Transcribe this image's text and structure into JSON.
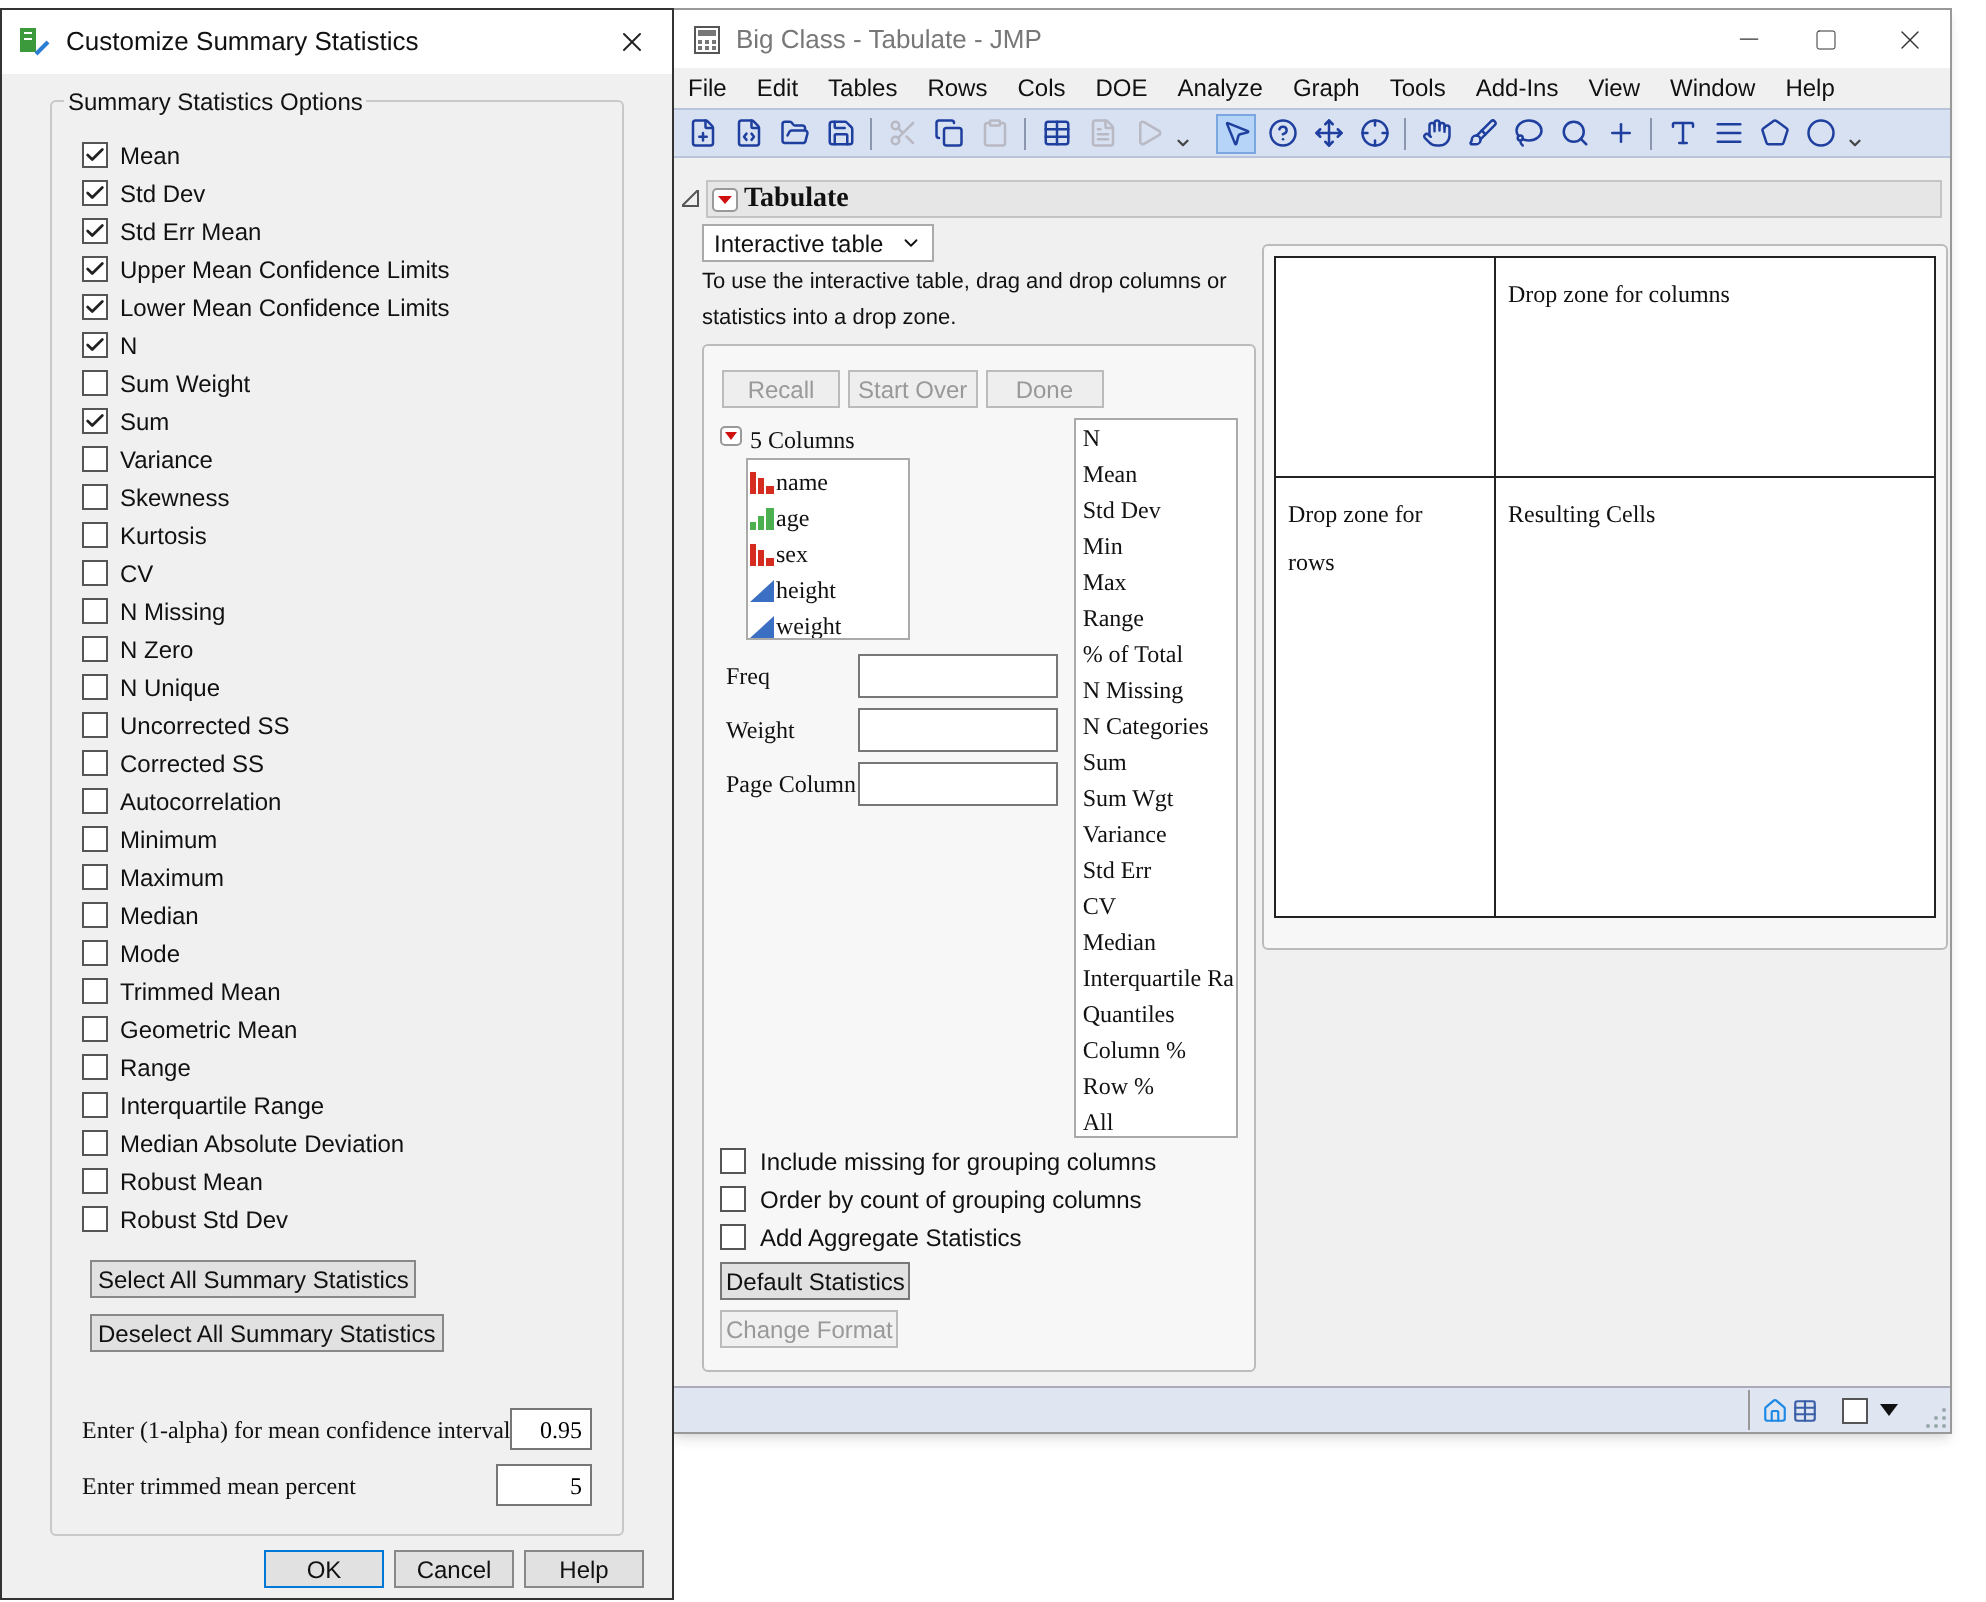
{
  "dialog": {
    "title": "Customize Summary Statistics",
    "group_title": "Summary Statistics Options",
    "options": [
      {
        "label": "Mean",
        "checked": true
      },
      {
        "label": "Std Dev",
        "checked": true
      },
      {
        "label": "Std Err Mean",
        "checked": true
      },
      {
        "label": "Upper Mean Confidence Limits",
        "checked": true
      },
      {
        "label": "Lower Mean Confidence Limits",
        "checked": true
      },
      {
        "label": "N",
        "checked": true
      },
      {
        "label": "Sum Weight",
        "checked": false
      },
      {
        "label": "Sum",
        "checked": true
      },
      {
        "label": "Variance",
        "checked": false
      },
      {
        "label": "Skewness",
        "checked": false
      },
      {
        "label": "Kurtosis",
        "checked": false
      },
      {
        "label": "CV",
        "checked": false
      },
      {
        "label": "N Missing",
        "checked": false
      },
      {
        "label": "N Zero",
        "checked": false
      },
      {
        "label": "N Unique",
        "checked": false
      },
      {
        "label": "Uncorrected SS",
        "checked": false
      },
      {
        "label": "Corrected SS",
        "checked": false
      },
      {
        "label": "Autocorrelation",
        "checked": false
      },
      {
        "label": "Minimum",
        "checked": false
      },
      {
        "label": "Maximum",
        "checked": false
      },
      {
        "label": "Median",
        "checked": false
      },
      {
        "label": "Mode",
        "checked": false
      },
      {
        "label": "Trimmed Mean",
        "checked": false
      },
      {
        "label": "Geometric Mean",
        "checked": false
      },
      {
        "label": "Range",
        "checked": false
      },
      {
        "label": "Interquartile Range",
        "checked": false
      },
      {
        "label": "Median Absolute Deviation",
        "checked": false
      },
      {
        "label": "Robust Mean",
        "checked": false
      },
      {
        "label": "Robust Std Dev",
        "checked": false
      }
    ],
    "select_buttons": [
      "Select All Summary Statistics",
      "Deselect All Summary Statistics"
    ],
    "fields": [
      {
        "label": "Enter (1-alpha) for mean confidence interval",
        "value": "0.95"
      },
      {
        "label": "Enter trimmed mean percent",
        "value": "5"
      }
    ],
    "footer_buttons": [
      {
        "label": "OK",
        "selected": true
      },
      {
        "label": "Cancel",
        "selected": false
      },
      {
        "label": "Help",
        "selected": false
      }
    ]
  },
  "window": {
    "title": "Big Class - Tabulate - JMP",
    "menu": [
      "File",
      "Edit",
      "Tables",
      "Rows",
      "Cols",
      "DOE",
      "Analyze",
      "Graph",
      "Tools",
      "Add-Ins",
      "View",
      "Window",
      "Help"
    ],
    "toolbar": [
      {
        "kind": "new-table",
        "disabled": false,
        "selected": false
      },
      {
        "kind": "new-script",
        "disabled": false,
        "selected": false
      },
      {
        "kind": "open",
        "disabled": false,
        "selected": false
      },
      {
        "kind": "save",
        "disabled": false,
        "selected": false
      },
      {
        "kind": "sep"
      },
      {
        "kind": "cut",
        "disabled": true,
        "selected": false
      },
      {
        "kind": "copy",
        "disabled": false,
        "selected": false
      },
      {
        "kind": "paste",
        "disabled": true,
        "selected": false
      },
      {
        "kind": "sep"
      },
      {
        "kind": "data-table",
        "disabled": false,
        "selected": false
      },
      {
        "kind": "report",
        "disabled": true,
        "selected": false
      },
      {
        "kind": "run",
        "disabled": true,
        "selected": false
      },
      {
        "kind": "more"
      },
      {
        "kind": "gap"
      },
      {
        "kind": "arrow",
        "disabled": false,
        "selected": true
      },
      {
        "kind": "help",
        "disabled": false,
        "selected": false
      },
      {
        "kind": "crosshair",
        "disabled": false,
        "selected": false
      },
      {
        "kind": "target",
        "disabled": false,
        "selected": false
      },
      {
        "kind": "sep"
      },
      {
        "kind": "hand",
        "disabled": false,
        "selected": false
      },
      {
        "kind": "brush",
        "disabled": false,
        "selected": false
      },
      {
        "kind": "lasso",
        "disabled": false,
        "selected": false
      },
      {
        "kind": "zoom",
        "disabled": false,
        "selected": false
      },
      {
        "kind": "plus",
        "disabled": false,
        "selected": false
      },
      {
        "kind": "sep"
      },
      {
        "kind": "text",
        "disabled": false,
        "selected": false
      },
      {
        "kind": "lines",
        "disabled": false,
        "selected": false
      },
      {
        "kind": "polygon",
        "disabled": false,
        "selected": false
      },
      {
        "kind": "ellipse",
        "disabled": false,
        "selected": false
      },
      {
        "kind": "more"
      }
    ],
    "report": {
      "title": "Tabulate",
      "mode": "Interactive table",
      "instructions": "To use the interactive table, drag and drop columns or statistics into a drop zone.",
      "action_buttons": [
        {
          "label": "Recall",
          "disabled": true
        },
        {
          "label": "Start Over",
          "disabled": true
        },
        {
          "label": "Done",
          "disabled": true
        }
      ],
      "columns_title": "5 Columns",
      "columns": [
        {
          "name": "name",
          "kind": "nominal"
        },
        {
          "name": "age",
          "kind": "ordinal"
        },
        {
          "name": "sex",
          "kind": "nominal"
        },
        {
          "name": "height",
          "kind": "continuous"
        },
        {
          "name": "weight",
          "kind": "continuous"
        }
      ],
      "roles": [
        "Freq",
        "Weight",
        "Page Column"
      ],
      "statistics": [
        "N",
        "Mean",
        "Std Dev",
        "Min",
        "Max",
        "Range",
        "% of Total",
        "N Missing",
        "N Categories",
        "Sum",
        "Sum Wgt",
        "Variance",
        "Std Err",
        "CV",
        "Median",
        "Interquartile Ra",
        "Quantiles",
        "Column %",
        "Row %",
        "All"
      ],
      "options": [
        {
          "label": "Include missing for grouping columns",
          "checked": false
        },
        {
          "label": "Order by count of grouping columns",
          "checked": false
        },
        {
          "label": "Add Aggregate Statistics",
          "checked": false
        }
      ],
      "buttons": [
        {
          "label": "Default Statistics",
          "disabled": false
        },
        {
          "label": "Change Format",
          "disabled": true
        }
      ],
      "drop_zone": {
        "columns": "Drop zone for columns",
        "rows": "Drop zone for rows",
        "cells": "Resulting Cells"
      }
    },
    "status_checkbox": {
      "checked": false
    }
  }
}
